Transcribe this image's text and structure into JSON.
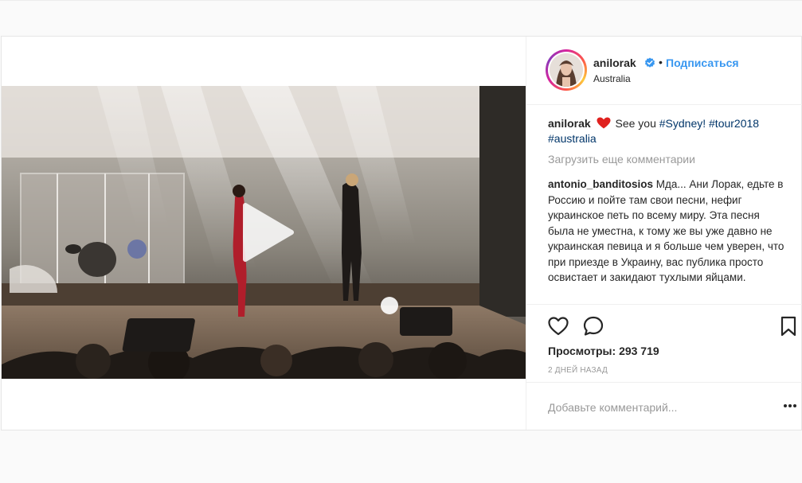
{
  "post": {
    "username": "anilorak",
    "follow_label": "Подписаться",
    "separator": "•",
    "location": "Australia"
  },
  "caption": {
    "user": "anilorak",
    "text_before": " See you ",
    "tags": [
      "#Sydney!",
      "#tour2018",
      "#australia"
    ]
  },
  "load_more_label": "Загрузить еще комментарии",
  "comment": {
    "user": "antonio_banditosios",
    "text": " Мда... Ани Лорак, едьте в Россию и пойте там свои песни, нефиг украинское петь по всему миру. Эта песня была не уместна, к тому же вы уже давно не украинская певица и я больше чем уверен, что при приезде в Украину, вас публика просто освистает и закидают тухлыми яйцами."
  },
  "stats": {
    "views_label": "Просмотры:",
    "views_value": "293 719",
    "time": "2 ДНЕЙ НАЗАД"
  },
  "add_comment": {
    "placeholder": "Добавьте комментарий..."
  },
  "icons": [
    "play-icon",
    "heart-icon",
    "comment-icon",
    "bookmark-icon",
    "verified-icon",
    "more-options-icon",
    "heart-emoji-icon"
  ],
  "colors": {
    "link_blue": "#3897f0",
    "hashtag": "#003569",
    "verified": "#3897f0",
    "muted": "#999999",
    "heart_emoji": "#e0211f"
  }
}
